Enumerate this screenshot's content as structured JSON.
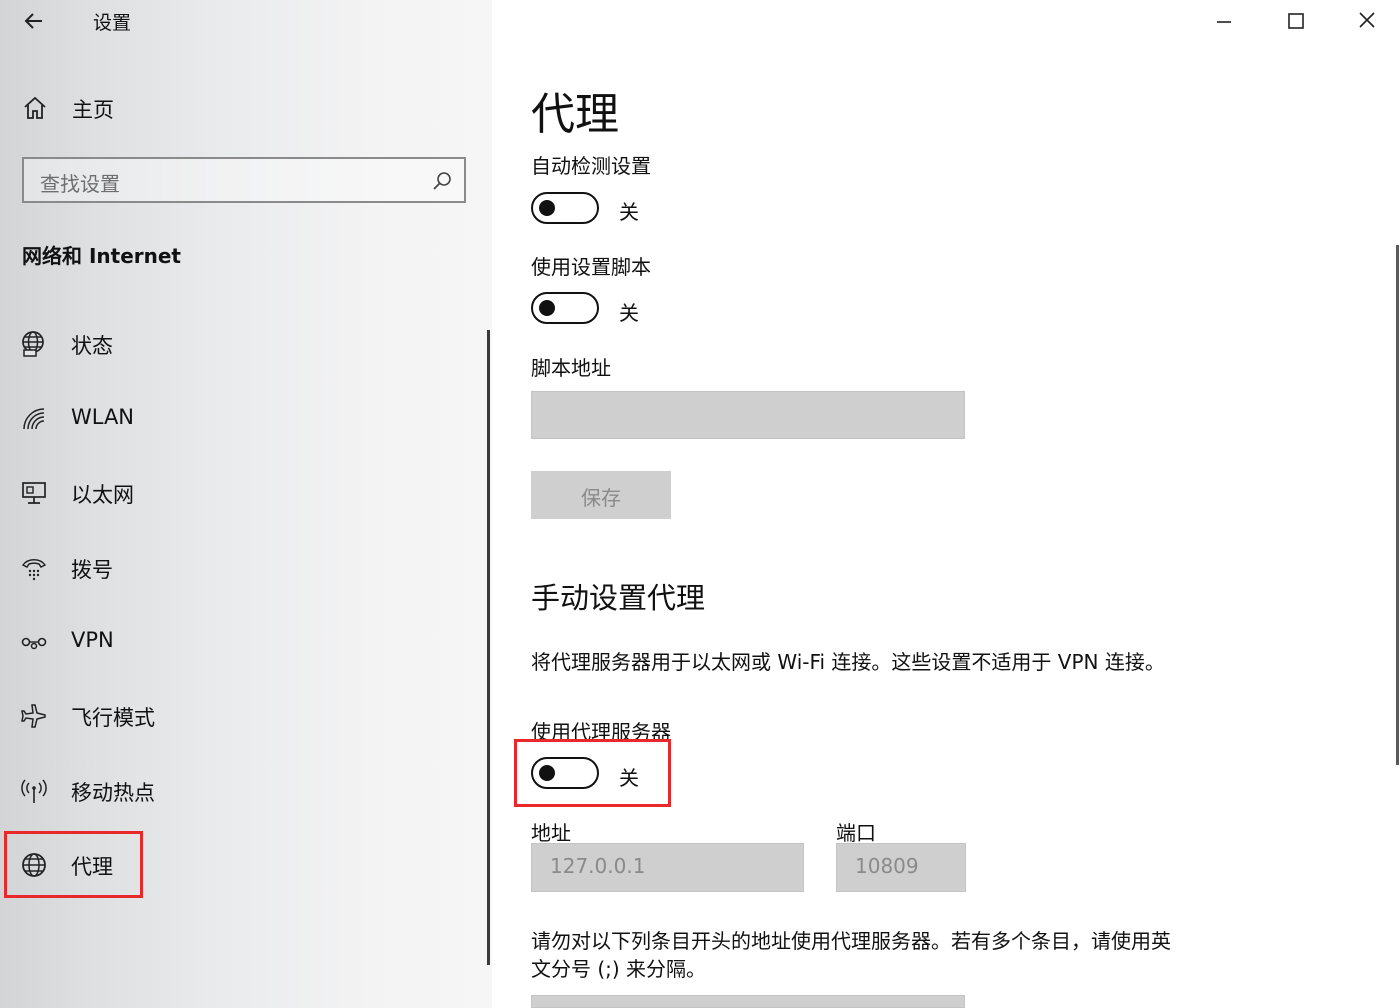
{
  "app": {
    "title": "设置"
  },
  "sidebar": {
    "home_label": "主页",
    "search_placeholder": "查找设置",
    "section_title": "网络和 Internet",
    "items": [
      {
        "label": "状态",
        "icon": "globe-status-icon"
      },
      {
        "label": "WLAN",
        "icon": "wifi-icon"
      },
      {
        "label": "以太网",
        "icon": "ethernet-icon"
      },
      {
        "label": "拨号",
        "icon": "dialup-icon"
      },
      {
        "label": "VPN",
        "icon": "vpn-icon"
      },
      {
        "label": "飞行模式",
        "icon": "airplane-icon"
      },
      {
        "label": "移动热点",
        "icon": "hotspot-icon"
      },
      {
        "label": "代理",
        "icon": "globe-icon",
        "selected": true
      }
    ]
  },
  "main": {
    "title": "代理",
    "auto_detect": {
      "label": "自动检测设置",
      "state": "关",
      "on": false
    },
    "use_script": {
      "label": "使用设置脚本",
      "state": "关",
      "on": false
    },
    "script_address": {
      "label": "脚本地址",
      "value": ""
    },
    "save_label": "保存",
    "manual_heading": "手动设置代理",
    "manual_desc": "将代理服务器用于以太网或 Wi-Fi 连接。这些设置不适用于 VPN 连接。",
    "use_proxy": {
      "label": "使用代理服务器",
      "state": "关",
      "on": false
    },
    "address": {
      "label": "地址",
      "value": "127.0.0.1"
    },
    "port": {
      "label": "端口",
      "value": "10809"
    },
    "exceptions_desc_line1": "请勿对以下列条目开头的地址使用代理服务器。若有多个条目，请使用英",
    "exceptions_desc_line2": "文分号 (;) 来分隔。"
  },
  "colors": {
    "highlight": "#e8282b",
    "disabled_bg": "#cfcfcf"
  }
}
